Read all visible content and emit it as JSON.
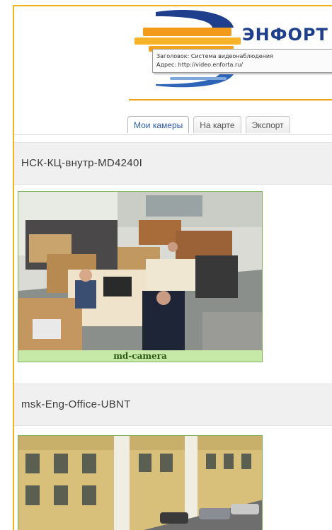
{
  "header": {
    "brand_text": "ЭНФОРТ",
    "tooltip_title": "Заголовок: Система видеонаблюдения",
    "tooltip_address": "Адрес: http://video.enforta.ru/",
    "accent_color": "#f0a21f",
    "brand_color": "#1f3f8c"
  },
  "tabs": [
    {
      "label": "Мои камеры",
      "active": true
    },
    {
      "label": "На карте",
      "active": false
    },
    {
      "label": "Экспорт",
      "active": false
    }
  ],
  "cameras": [
    {
      "title": "НСК-КЦ-внутр-MD4240I",
      "thumb_label": "md-camera"
    },
    {
      "title": "msk-Eng-Office-UBNT",
      "thumb_label": ""
    }
  ]
}
